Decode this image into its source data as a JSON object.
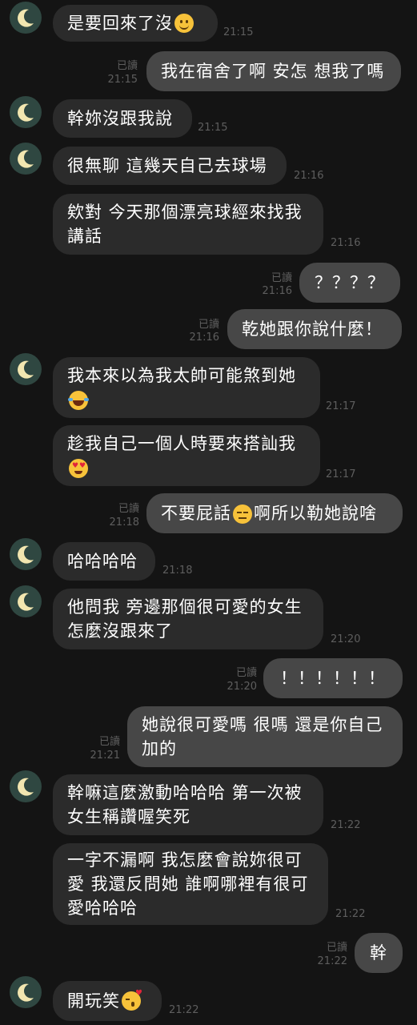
{
  "messages": [
    {
      "side": "in",
      "text": "是要回來了沒",
      "emoji": "smile",
      "time": "21:15"
    },
    {
      "side": "out",
      "text": "我在宿舍了啊 安怎 想我了嗎",
      "read": "已讀",
      "time": "21:15"
    },
    {
      "side": "in",
      "text": "幹妳沒跟我說",
      "time": "21:15"
    },
    {
      "side": "in",
      "text": "很無聊 這幾天自己去球場",
      "time": "21:16"
    },
    {
      "side": "in",
      "text": "欸對 今天那個漂亮球經來找我講話",
      "time": "21:16"
    },
    {
      "side": "out",
      "text": "？？？？",
      "read": "已讀",
      "time": "21:16"
    },
    {
      "side": "out",
      "text": "乾她跟你說什麼！",
      "read": "已讀",
      "time": "21:16"
    },
    {
      "side": "in",
      "text": "我本來以為我太帥可能煞到她",
      "emoji": "laugh",
      "time": "21:17"
    },
    {
      "side": "in",
      "text": "趁我自己一個人時要來搭訕我",
      "emoji": "heart",
      "time": "21:17"
    },
    {
      "side": "out",
      "text_a": "不要屁話",
      "text_b": "啊所以勒她說啥",
      "emoji": "flat",
      "read": "已讀",
      "time": "21:18"
    },
    {
      "side": "in",
      "text": "哈哈哈哈",
      "time": "21:18"
    },
    {
      "side": "in",
      "text": "他問我 旁邊那個很可愛的女生怎麼沒跟來了",
      "time": "21:20"
    },
    {
      "side": "out",
      "text": "！！！！！！",
      "read": "已讀",
      "time": "21:20"
    },
    {
      "side": "out",
      "text": "她說很可愛嗎 很嗎 還是你自己加的",
      "read": "已讀",
      "time": "21:21"
    },
    {
      "side": "in",
      "text": "幹嘛這麼激動哈哈哈 第一次被女生稱讚喔笑死",
      "time": "21:22"
    },
    {
      "side": "in",
      "text": "一字不漏啊 我怎麼會說妳很可愛 我還反問她 誰啊哪裡有很可愛哈哈哈",
      "time": "21:22"
    },
    {
      "side": "out",
      "text": "幹",
      "read": "已讀",
      "time": "21:22"
    },
    {
      "side": "in",
      "text": "開玩笑",
      "emoji": "kiss",
      "time": "21:22"
    }
  ]
}
